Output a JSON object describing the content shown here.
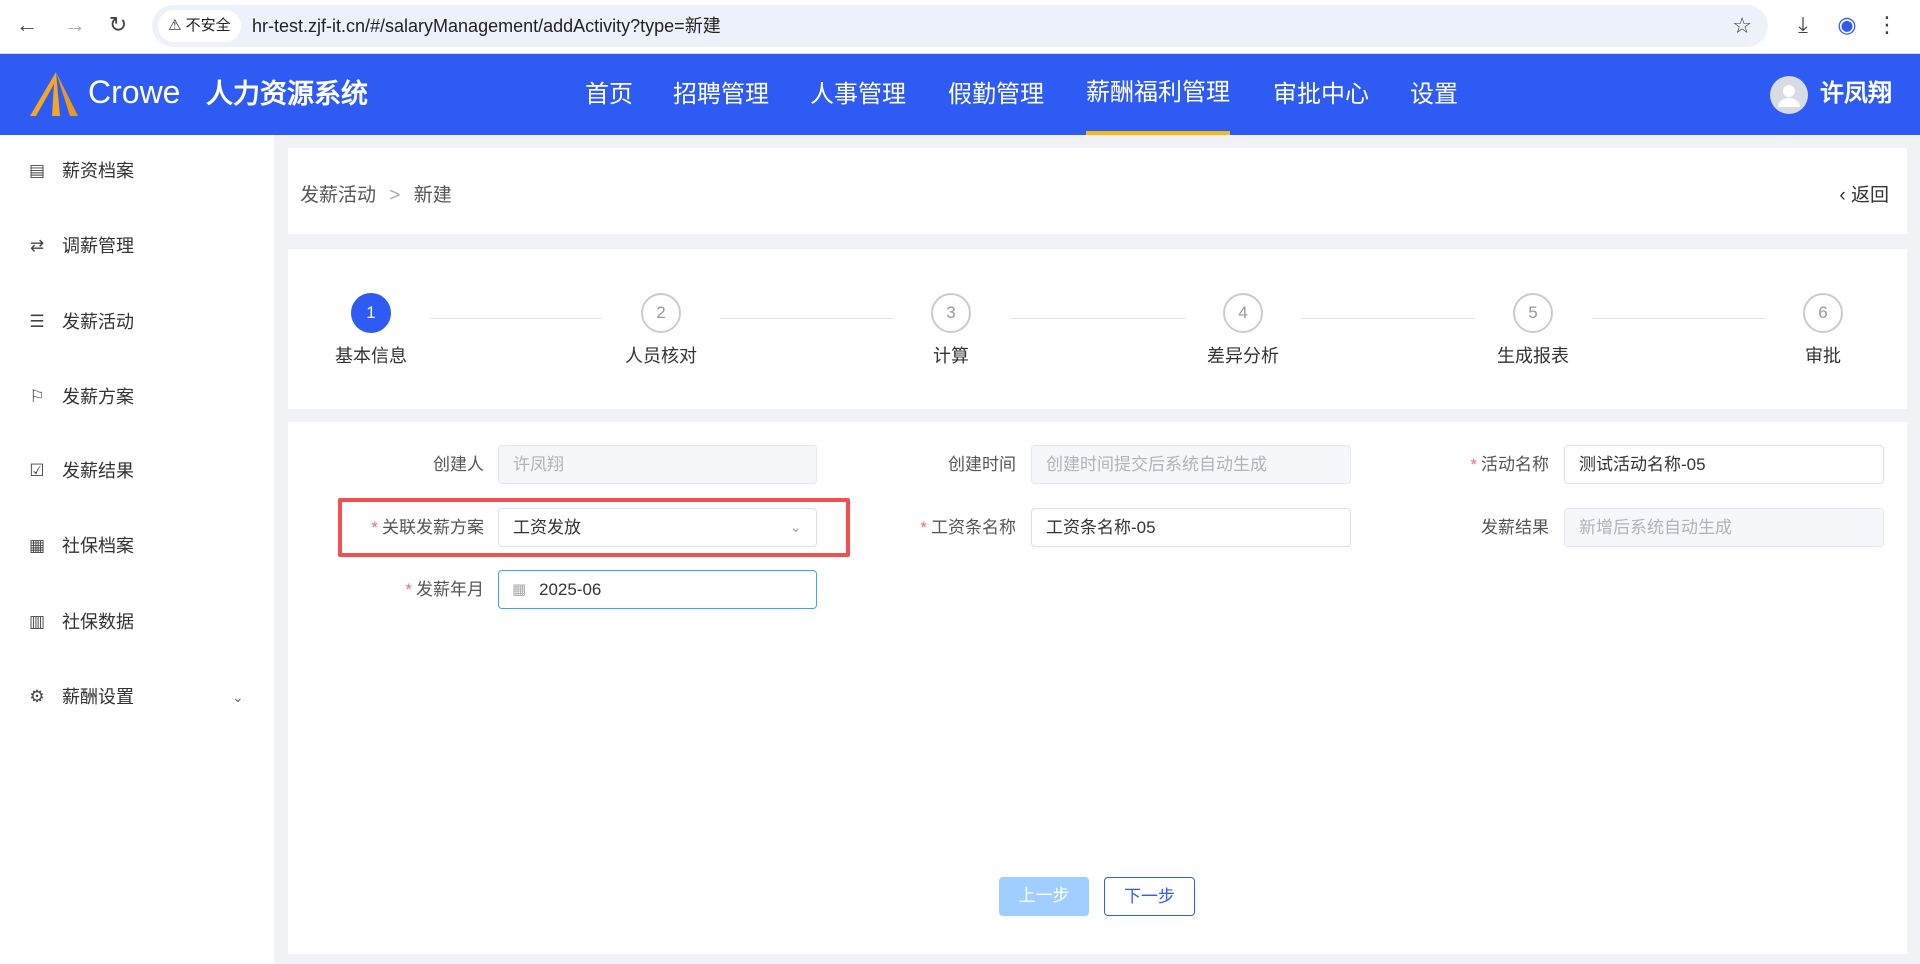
{
  "browser": {
    "insecure_label": "不安全",
    "url": "hr-test.zjf-it.cn/#/salaryManagement/addActivity?type=新建"
  },
  "header": {
    "logo": "Crowe",
    "system_name": "人力资源系统",
    "nav": [
      "首页",
      "招聘管理",
      "人事管理",
      "假勤管理",
      "薪酬福利管理",
      "审批中心",
      "设置"
    ],
    "active_nav": "薪酬福利管理",
    "user": "许凤翔",
    "accent": "#2f5bf5",
    "underline": "#f5b90f"
  },
  "sidebar": {
    "items": [
      "薪资档案",
      "调薪管理",
      "发薪活动",
      "发薪方案",
      "发薪结果",
      "社保档案",
      "社保数据",
      "薪酬设置"
    ]
  },
  "breadcrumb": {
    "parent": "发薪活动",
    "sep": ">",
    "current": "新建",
    "back": "返回"
  },
  "steps": [
    {
      "n": "1",
      "label": "基本信息"
    },
    {
      "n": "2",
      "label": "人员核对"
    },
    {
      "n": "3",
      "label": "计算"
    },
    {
      "n": "4",
      "label": "差异分析"
    },
    {
      "n": "5",
      "label": "生成报表"
    },
    {
      "n": "6",
      "label": "审批"
    }
  ],
  "form": {
    "creator": {
      "label": "创建人",
      "value": "许凤翔"
    },
    "created_time": {
      "label": "创建时间",
      "placeholder": "创建时间提交后系统自动生成"
    },
    "activity_name": {
      "label": "活动名称",
      "value": "测试活动名称-05"
    },
    "plan": {
      "label": "关联发薪方案",
      "value": "工资发放"
    },
    "slip_name": {
      "label": "工资条名称",
      "value": "工资条名称-05"
    },
    "result": {
      "label": "发薪结果",
      "placeholder": "新增后系统自动生成"
    },
    "month": {
      "label": "发薪年月",
      "value": "2025-06"
    },
    "required_mark": "*"
  },
  "buttons": {
    "prev": "上一步",
    "next": "下一步"
  }
}
